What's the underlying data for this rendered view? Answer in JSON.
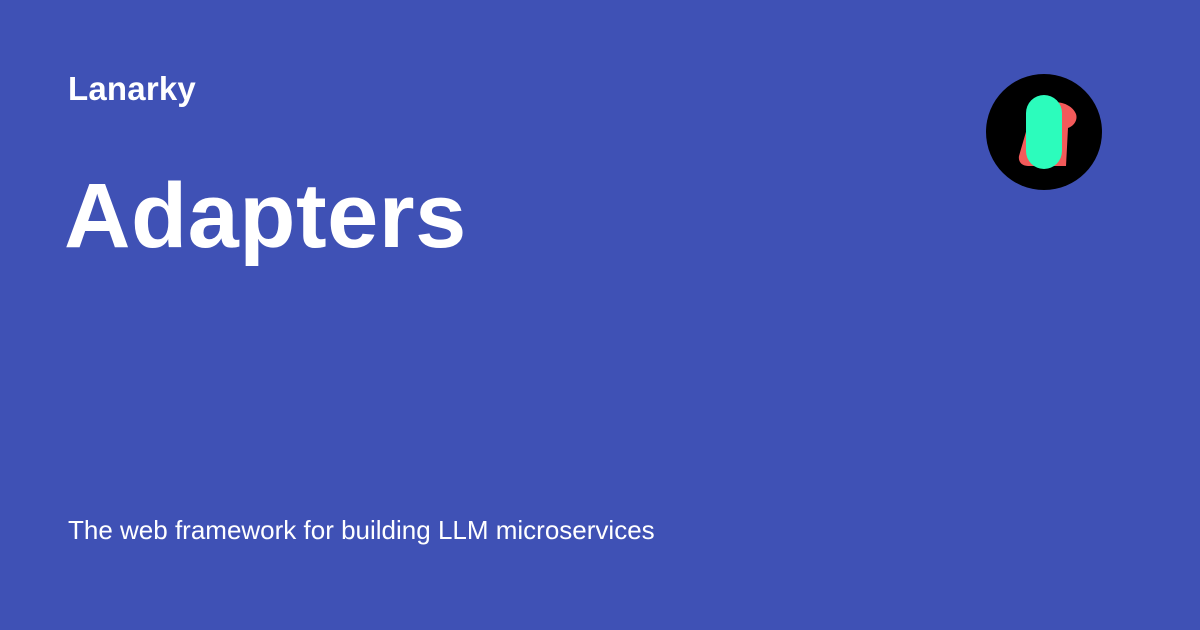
{
  "site": {
    "name": "Lanarky"
  },
  "page": {
    "title": "Adapters",
    "tagline": "The web framework for building LLM microservices"
  },
  "colors": {
    "background": "#3f51b5",
    "text": "#ffffff",
    "logo_circle": "#000000",
    "logo_pill": "#2cfcbc",
    "logo_accent": "#f35a5a"
  },
  "icons": {
    "logo": "lanarky-logo-icon"
  }
}
